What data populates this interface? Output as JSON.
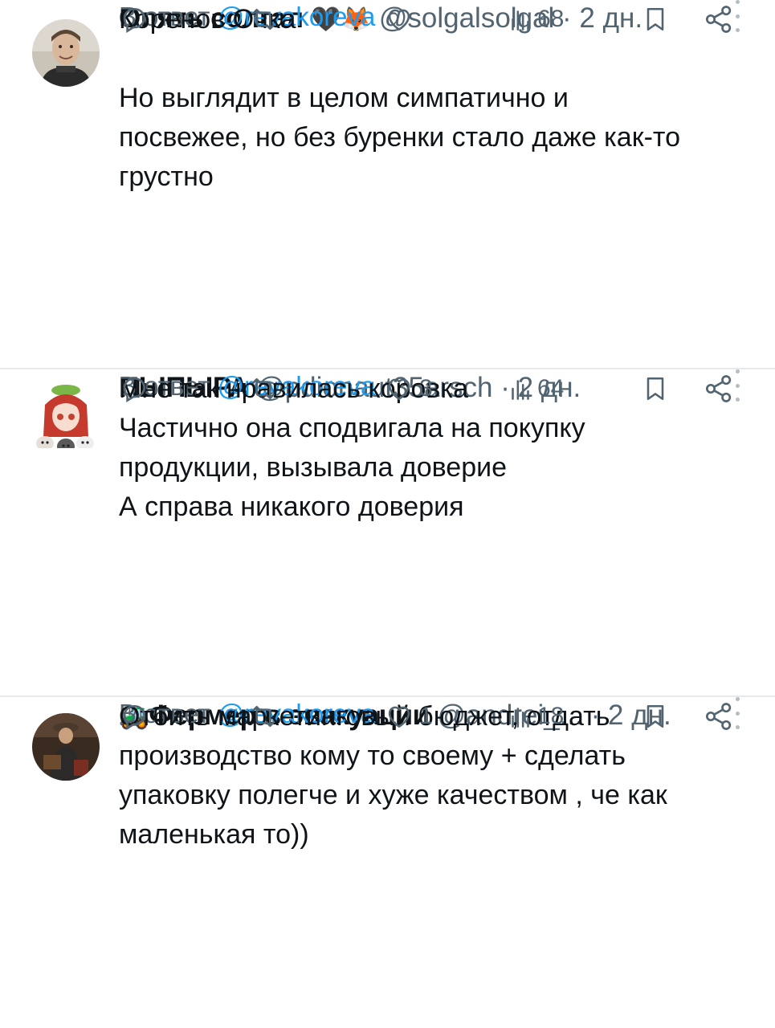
{
  "tweets": [
    {
      "display_name": "Опять солгал",
      "name_emoji": "🖤🦊",
      "handle": "@solgalsolgal",
      "dot": "·",
      "time": "2 дн.",
      "reply_prefix": "В ответ",
      "reply_to": "@revakoreva",
      "lines": [
        "Коренов Очка",
        "",
        "Но выглядит в целом симпатично и",
        "посвежее, но без буренки стало даже как-то",
        "грустно"
      ],
      "likes": "",
      "views": "68",
      "avatar_icon": "avatar-man-smiling"
    },
    {
      "display_name": "ПЫПЫРА",
      "name_emoji": "",
      "handle": "@pdionaut35arsch",
      "dot": "·",
      "time": "2 дн.",
      "reply_prefix": "В ответ",
      "reply_to": "@revakoreva",
      "lines": [
        "Мне так нравилась коровка",
        "Частично она сподвигала на покупку",
        "продукции, вызывала доверие",
        "А справа никакого доверия"
      ],
      "likes": "3",
      "views": "64",
      "avatar_icon": "avatar-anime-girl-with-cats"
    },
    {
      "display_name": "Фермер в эвакуации",
      "name_emoji": "🚜",
      "handle": "@andrei_...",
      "dot": "·",
      "time": "2 дн.",
      "reply_prefix": "В ответ",
      "reply_to": "@revakoreva",
      "lines": [
        "Отбить маркетинговый бюджет, отдать",
        "производство кому то своему + сделать",
        "упаковку полегче и хуже качеством , че как",
        "маленькая то))"
      ],
      "likes": "1",
      "views": "18",
      "avatar_icon": "avatar-man-in-hat"
    }
  ],
  "colors": {
    "text": "#0f1419",
    "secondary": "#536471",
    "link": "#1d9bf0",
    "divider": "#e7e9ec"
  }
}
